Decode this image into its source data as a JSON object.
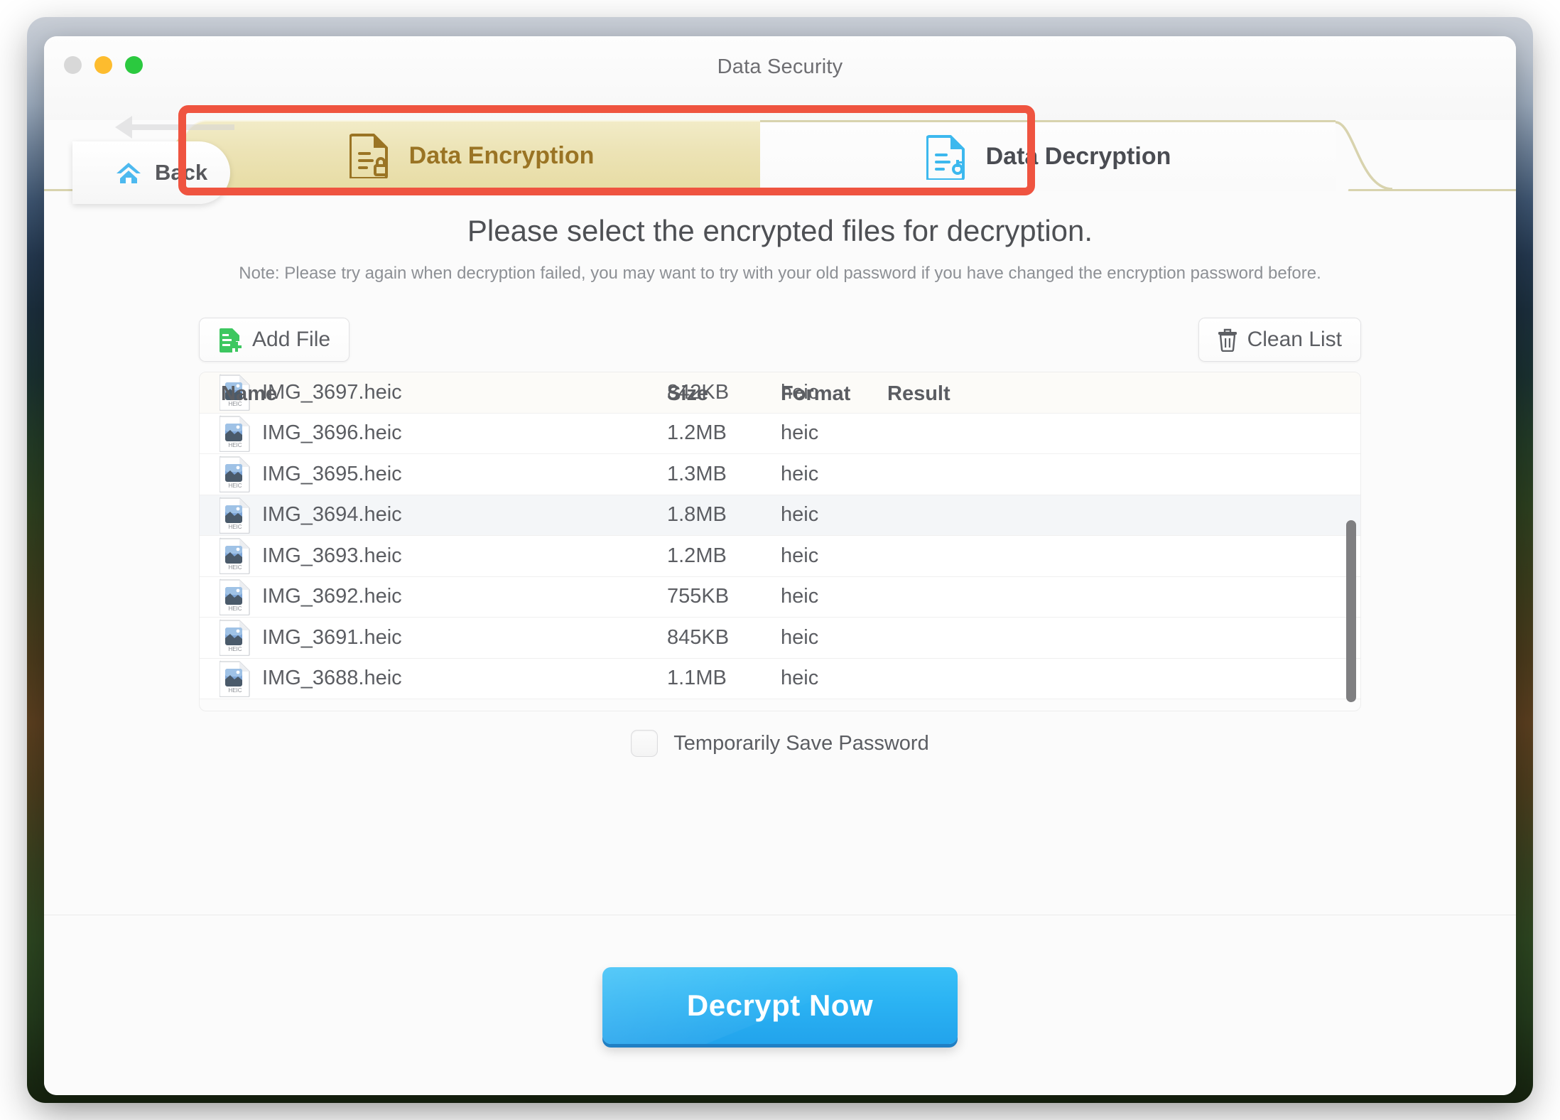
{
  "window": {
    "title": "Data Security",
    "traffic_lights": [
      "close-button",
      "minimize-button",
      "maximize-button"
    ]
  },
  "nav": {
    "back_label": "Back",
    "back_icon": "home-icon",
    "arrow_icon": "back-arrow-icon"
  },
  "tabs": [
    {
      "label": "Data Encryption",
      "icon": "document-lock-icon",
      "active": false
    },
    {
      "label": "Data Decryption",
      "icon": "document-key-icon",
      "active": true
    }
  ],
  "content": {
    "heading": "Please select the encrypted files for decryption.",
    "note": "Note: Please try again when decryption failed, you may want to try with your old password if you have changed the encryption password before."
  },
  "toolbar": {
    "add_file_label": "Add File",
    "add_file_icon": "document-plus-icon",
    "clean_list_label": "Clean List",
    "clean_list_icon": "trash-icon"
  },
  "filelist": {
    "columns": [
      "Name",
      "Size",
      "Format",
      "Result"
    ],
    "rows": [
      {
        "name": "IMG_3697.heic",
        "size": "842KB",
        "format": "heic",
        "result": ""
      },
      {
        "name": "IMG_3696.heic",
        "size": "1.2MB",
        "format": "heic",
        "result": ""
      },
      {
        "name": "IMG_3695.heic",
        "size": "1.3MB",
        "format": "heic",
        "result": ""
      },
      {
        "name": "IMG_3694.heic",
        "size": "1.8MB",
        "format": "heic",
        "result": ""
      },
      {
        "name": "IMG_3693.heic",
        "size": "1.2MB",
        "format": "heic",
        "result": ""
      },
      {
        "name": "IMG_3692.heic",
        "size": "755KB",
        "format": "heic",
        "result": ""
      },
      {
        "name": "IMG_3691.heic",
        "size": "845KB",
        "format": "heic",
        "result": ""
      },
      {
        "name": "IMG_3688.heic",
        "size": "1.1MB",
        "format": "heic",
        "result": ""
      }
    ],
    "file_icon_label": "HEIC"
  },
  "options": {
    "save_password_label": "Temporarily Save Password",
    "save_password_checked": false
  },
  "footer": {
    "primary_button": "Decrypt Now"
  },
  "colors": {
    "annotation": "#ef5440",
    "tab_active_text": "#4a4c52",
    "tab_inactive_text": "#9a7424",
    "primary_button": "#2bb3f3",
    "add_icon": "#3dc760",
    "decrypt_icon": "#3cb8ee",
    "encrypt_icon": "#9a7424"
  }
}
